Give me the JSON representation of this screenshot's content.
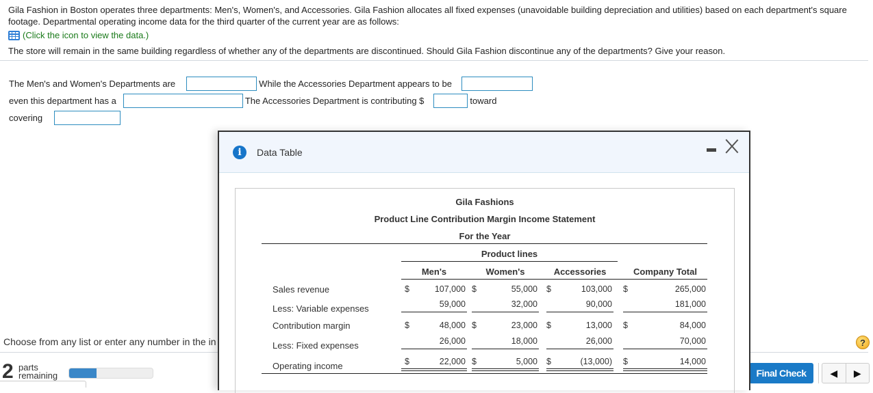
{
  "problem": {
    "intro": "Gila Fashion in Boston operates three departments: Men's, Women's, and Accessories. Gila Fashion allocates all fixed expenses (unavoidable building depreciation and utilities) based on each department's square footage. Departmental operating income data for the third quarter of the current year are as follows:",
    "data_link": "(Click the icon to view the data.)",
    "question": "The store will remain in the same building regardless of whether any of the departments are discontinued. Should Gila Fashion discontinue any of the departments? Give your reason."
  },
  "answer": {
    "line1_prefix": "The Men's and Women's Departments are",
    "line1_mid": "While the Accessories Department appears to be",
    "line2_prefix": "even this department has a",
    "line2_mid": "The Accessories Department is contributing $",
    "line2_suffix": "toward",
    "line3_prefix": "covering",
    "inputs": [
      "",
      "",
      "",
      "",
      ""
    ]
  },
  "footer": {
    "prompt": "Choose from any list or enter any number in the in",
    "parts_count": "2",
    "parts_label_1": "parts",
    "parts_label_2": "remaining",
    "progress_fraction": 0.33,
    "help": "?",
    "final_check": "Final Check",
    "prev": "◀",
    "next": "▶"
  },
  "modal": {
    "title": "Data Table",
    "statement": {
      "company": "Gila Fashions",
      "title": "Product Line Contribution Margin Income Statement",
      "period": "For the Year",
      "group_header": "Product lines",
      "columns": [
        "Men's",
        "Women's",
        "Accessories",
        "Company Total"
      ],
      "rows": [
        {
          "label": "Sales revenue",
          "values": [
            "107,000",
            "55,000",
            "103,000",
            "265,000"
          ],
          "dollar": true
        },
        {
          "label": "Less: Variable expenses",
          "values": [
            "59,000",
            "32,000",
            "90,000",
            "181,000"
          ],
          "dollar": false
        },
        {
          "label": "Contribution margin",
          "values": [
            "48,000",
            "23,000",
            "13,000",
            "84,000"
          ],
          "dollar": true
        },
        {
          "label": "Less: Fixed expenses",
          "values": [
            "26,000",
            "18,000",
            "26,000",
            "70,000"
          ],
          "dollar": false
        },
        {
          "label": "Operating income",
          "values": [
            "22,000",
            "5,000",
            "(13,000)",
            "14,000"
          ],
          "dollar": true
        }
      ]
    }
  }
}
